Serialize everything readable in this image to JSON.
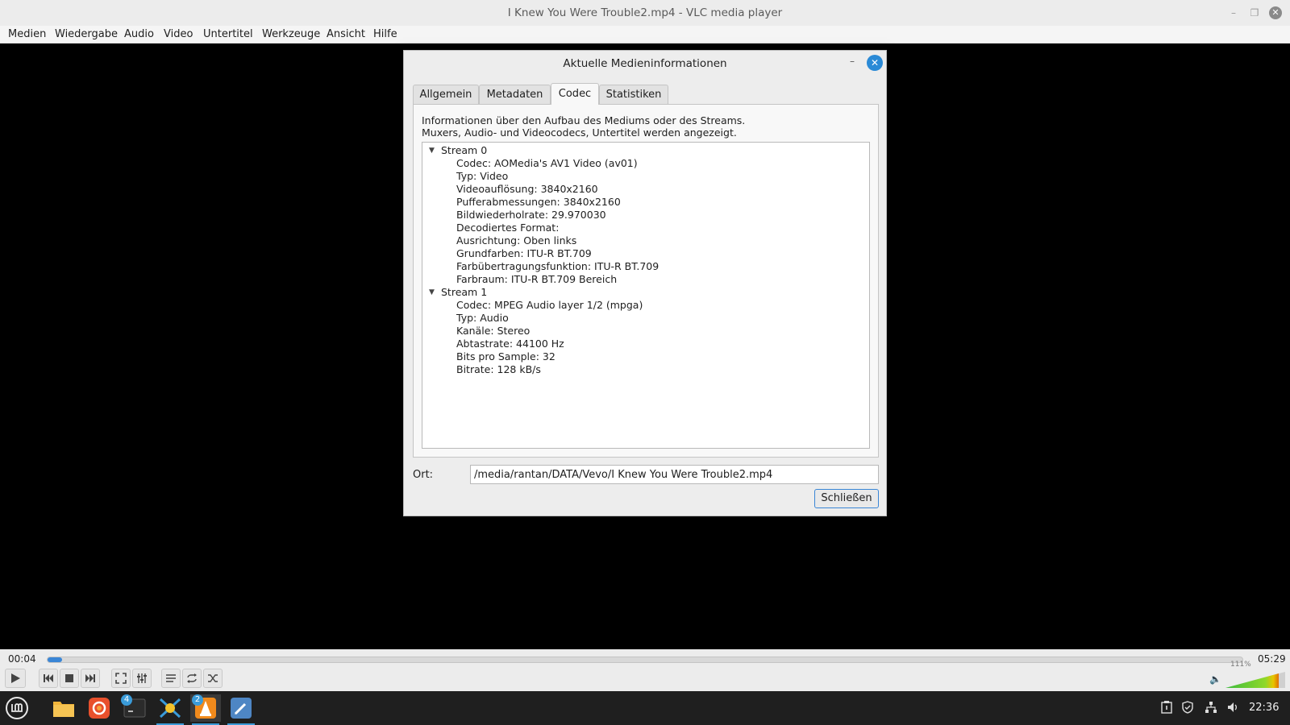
{
  "window": {
    "title": "I Knew You Were Trouble2.mp4 - VLC media player"
  },
  "menubar": {
    "items": [
      "Medien",
      "Wiedergabe",
      "Audio",
      "Video",
      "Untertitel",
      "Werkzeuge",
      "Ansicht",
      "Hilfe"
    ]
  },
  "dialog": {
    "title": "Aktuelle Medieninformationen",
    "tabs": [
      "Allgemein",
      "Metadaten",
      "Codec",
      "Statistiken"
    ],
    "active_tab": "Codec",
    "info_line1": "Informationen über den Aufbau des Mediums oder des Streams.",
    "info_line2": "Muxers, Audio- und Videocodecs, Untertitel werden angezeigt.",
    "streams": [
      {
        "label": "Stream 0",
        "expanded": true,
        "props": [
          "Codec: AOMedia's AV1 Video (av01)",
          "Typ: Video",
          "Videoauflösung: 3840x2160",
          "Pufferabmessungen: 3840x2160",
          "Bildwiederholrate: 29.970030",
          "Decodiertes Format:",
          "Ausrichtung: Oben links",
          "Grundfarben: ITU-R BT.709",
          "Farbübertragungsfunktion: ITU-R BT.709",
          "Farbraum: ITU-R BT.709 Bereich"
        ]
      },
      {
        "label": "Stream 1",
        "expanded": true,
        "props": [
          "Codec: MPEG Audio layer 1/2 (mpga)",
          "Typ: Audio",
          "Kanäle: Stereo",
          "Abtastrate: 44100 Hz",
          "Bits pro Sample: 32",
          "Bitrate: 128 kB/s"
        ]
      }
    ],
    "location_label": "Ort:",
    "location_value": "/media/rantan/DATA/Vevo/I Knew You Were Trouble2.mp4",
    "close_label": "Schließen"
  },
  "player": {
    "elapsed": "00:04",
    "total": "05:29",
    "progress_fraction": 0.012,
    "volume_label": "111%",
    "volume_level": 1.11
  },
  "taskbar": {
    "terminal_badge": "4",
    "vlc_badge": "2",
    "clock": "22:36"
  },
  "colors": {
    "accent": "#3a86d6",
    "taskbar_bg": "#1f1f1f",
    "dialog_close": "#2b8ad6"
  }
}
